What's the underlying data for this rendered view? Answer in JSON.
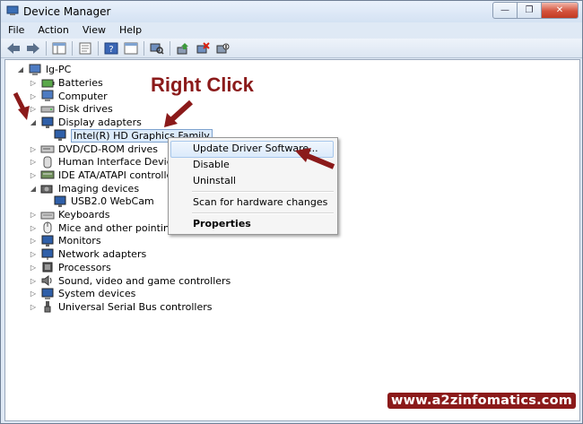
{
  "window": {
    "title": "Device Manager",
    "min_label": "—",
    "max_label": "❐",
    "close_label": "✕"
  },
  "menu": {
    "items": [
      "File",
      "Action",
      "View",
      "Help"
    ]
  },
  "tree": {
    "root": "lg-PC",
    "items": [
      {
        "label": "Batteries",
        "icon": "battery-icon",
        "expanded": false
      },
      {
        "label": "Computer",
        "icon": "computer-icon",
        "expanded": false
      },
      {
        "label": "Disk drives",
        "icon": "disk-drive-icon",
        "expanded": false
      },
      {
        "label": "Display adapters",
        "icon": "monitor-icon",
        "expanded": true
      },
      {
        "label": "Intel(R) HD Graphics Family",
        "icon": "display-adapter-icon",
        "child": true,
        "selected": true
      },
      {
        "label": "DVD/CD-ROM drives",
        "icon": "dvd-icon",
        "expanded": false
      },
      {
        "label": "Human Interface Devices",
        "icon": "hid-icon",
        "expanded": false
      },
      {
        "label": "IDE ATA/ATAPI controllers",
        "icon": "ide-icon",
        "expanded": false
      },
      {
        "label": "Imaging devices",
        "icon": "camera-icon",
        "expanded": true
      },
      {
        "label": "USB2.0 WebCam",
        "icon": "webcam-icon",
        "child": true
      },
      {
        "label": "Keyboards",
        "icon": "keyboard-icon",
        "expanded": false
      },
      {
        "label": "Mice and other pointing devices",
        "icon": "mouse-icon",
        "expanded": false
      },
      {
        "label": "Monitors",
        "icon": "monitor-icon",
        "expanded": false
      },
      {
        "label": "Network adapters",
        "icon": "network-icon",
        "expanded": false
      },
      {
        "label": "Processors",
        "icon": "processor-icon",
        "expanded": false
      },
      {
        "label": "Sound, video and game controllers",
        "icon": "sound-icon",
        "expanded": false
      },
      {
        "label": "System devices",
        "icon": "system-icon",
        "expanded": false
      },
      {
        "label": "Universal Serial Bus controllers",
        "icon": "usb-icon",
        "expanded": false
      }
    ]
  },
  "context_menu": {
    "update": "Update Driver Software...",
    "disable": "Disable",
    "uninstall": "Uninstall",
    "scan": "Scan for hardware changes",
    "properties": "Properties"
  },
  "annotation": {
    "text": "Right Click",
    "color": "#8b1a1a"
  },
  "watermark": "www.a2zinfomatics.com"
}
